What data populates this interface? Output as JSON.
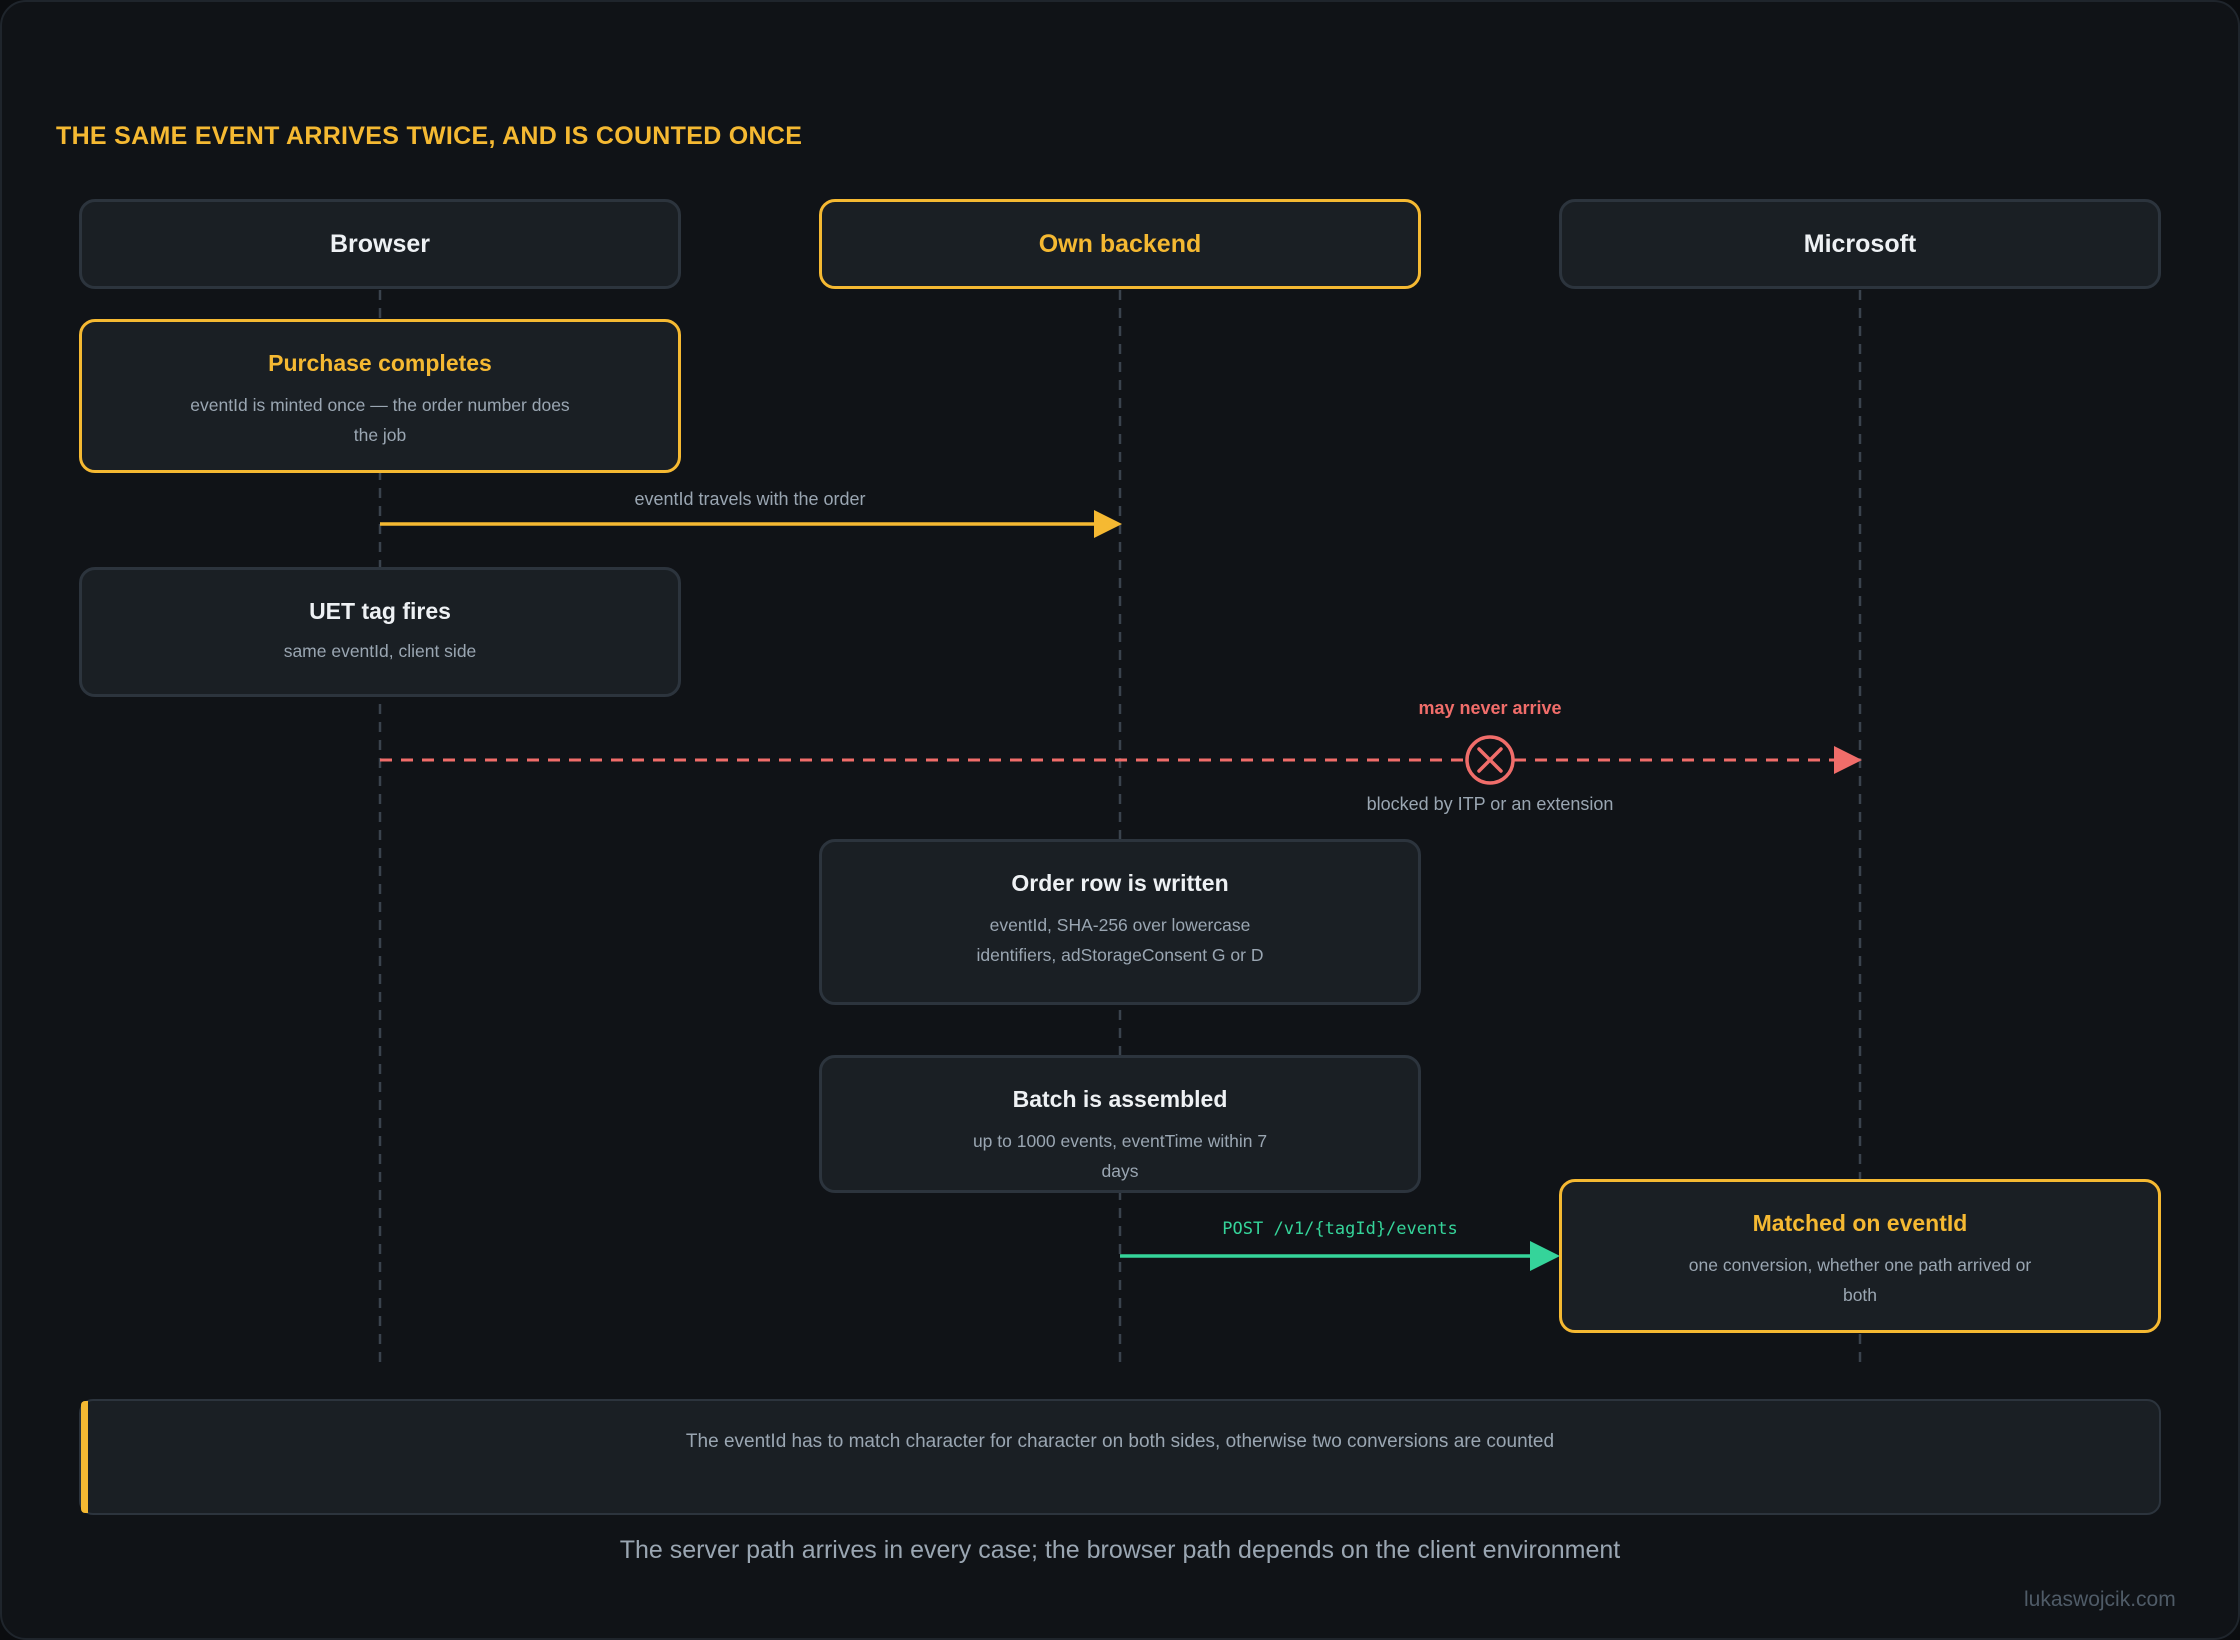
{
  "title": "THE SAME EVENT ARRIVES TWICE, AND IS COUNTED ONCE",
  "actors": {
    "browser": "Browser",
    "backend": "Own backend",
    "microsoft": "Microsoft"
  },
  "steps": {
    "purchase": {
      "title": "Purchase completes",
      "desc": "eventId is minted once — the order number does the job"
    },
    "uet": {
      "title": "UET tag fires",
      "desc": "same eventId, client side"
    },
    "order_row": {
      "title": "Order row is written",
      "desc": "eventId, SHA-256 over lowercase identifiers, adStorageConsent G or D"
    },
    "batch": {
      "title": "Batch is assembled",
      "desc": "up to 1000 events, eventTime within 7 days"
    },
    "matched": {
      "title": "Matched on eventId",
      "desc": "one conversion, whether one path arrived or both"
    }
  },
  "messages": {
    "order_label": "eventId travels with the order",
    "blocked_top": "may never arrive",
    "blocked_bottom": "blocked by ITP or an extension",
    "post_label": "POST /v1/{tagId}/events"
  },
  "note": "The eventId has to match character for character on both sides, otherwise two conversions are counted",
  "caption": "The server path arrives in every case; the browser path depends on the client environment",
  "credit": "lukaswojcik.com",
  "icons": {
    "blocked": "x-circle-icon"
  },
  "colors": {
    "accent": "#f5b932",
    "danger": "#f06d6a",
    "success": "#35d49a",
    "background": "#101317",
    "panel": "#1a1f24",
    "muted": "#9aa6b2"
  }
}
